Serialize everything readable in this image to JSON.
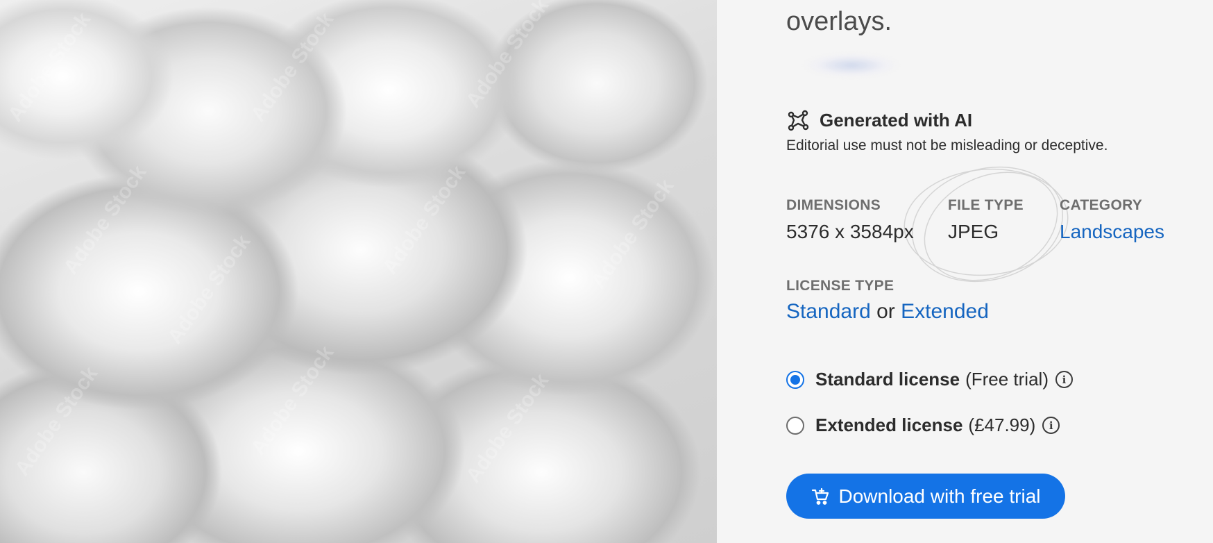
{
  "heading": {
    "text": "overlays."
  },
  "image": {
    "watermark": "Adobe Stock"
  },
  "ai_badge": {
    "icon": "ai-generated-icon",
    "title": "Generated with AI",
    "note": "Editorial use must not be misleading or deceptive."
  },
  "meta": {
    "dimensions_label": "DIMENSIONS",
    "dimensions_value": "5376 x 3584px",
    "filetype_label": "FILE TYPE",
    "filetype_value": "JPEG",
    "category_label": "CATEGORY",
    "category_value": "Landscapes"
  },
  "license_type": {
    "label": "LICENSE TYPE",
    "option_a": "Standard",
    "joiner": "or",
    "option_b": "Extended"
  },
  "licenses": [
    {
      "title": "Standard license",
      "detail": "(Free trial)",
      "selected": true,
      "info_icon": "info-icon"
    },
    {
      "title": "Extended license",
      "detail": "(£47.99)",
      "selected": false,
      "info_icon": "info-icon"
    }
  ],
  "download": {
    "icon": "cart-add-icon",
    "label": "Download with free trial"
  },
  "colors": {
    "accent": "#1473e6",
    "link": "#1565c0",
    "background": "#f5f5f5"
  }
}
